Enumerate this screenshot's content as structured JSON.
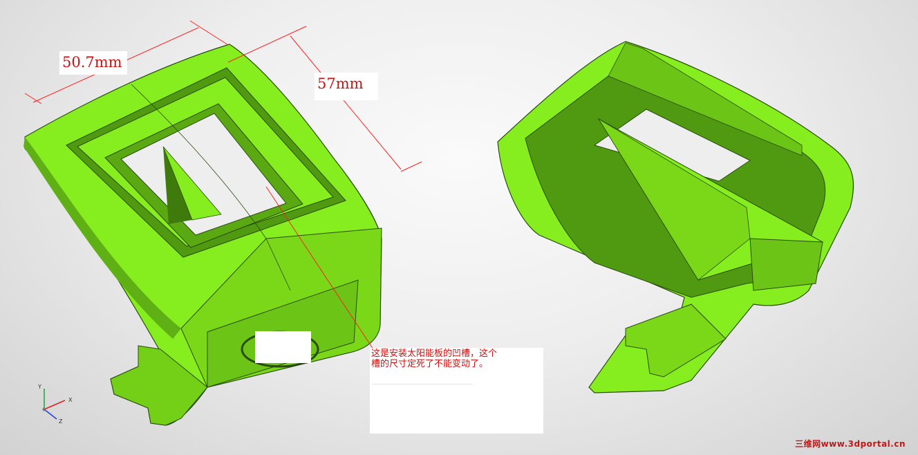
{
  "dimensions": {
    "width_label": "50.7mm",
    "depth_label": "57mm"
  },
  "annotation": {
    "line1": "这是安装太阳能板的凹槽，这个",
    "line2": "槽的尺寸定死了不能变动了。"
  },
  "triad": {
    "x": "X",
    "y": "Y",
    "z": "Z"
  },
  "watermark": "三维网www.3dportal.cn",
  "colors": {
    "part_face": "#86ee1e",
    "part_shadow": "#3f7a0c",
    "dimension_line": "#ff2020",
    "annotation_text": "#cc1010"
  }
}
